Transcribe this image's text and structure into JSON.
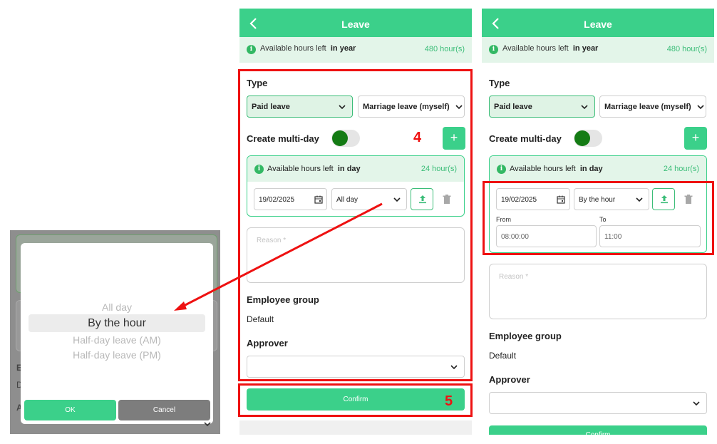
{
  "picker": {
    "options": [
      "All day",
      "By the hour",
      "Half-day leave (AM)",
      "Half-day leave (PM)"
    ],
    "selected_index": 1,
    "ok_label": "OK",
    "cancel_label": "Cancel",
    "ghost_letters": [
      "E",
      "D",
      "A"
    ]
  },
  "screen1": {
    "header_title": "Leave",
    "avail_label": "Available hours left",
    "avail_period": "in year",
    "avail_hours": "480 hour(s)",
    "type_label": "Type",
    "leave_type": "Paid leave",
    "leave_subtype": "Marriage leave (myself)",
    "multiday_label": "Create multi-day",
    "plus_symbol": "+",
    "day_avail_label": "Available hours left",
    "day_avail_period": "in day",
    "day_avail_hours": "24 hour(s)",
    "date_value": "19/02/2025",
    "duration_value": "All day",
    "reason_placeholder": "Reason *",
    "employee_group_label": "Employee group",
    "employee_group_value": "Default",
    "approver_label": "Approver",
    "confirm_label": "Confirm"
  },
  "screen2": {
    "header_title": "Leave",
    "avail_label": "Available hours left",
    "avail_period": "in year",
    "avail_hours": "480 hour(s)",
    "type_label": "Type",
    "leave_type": "Paid leave",
    "leave_subtype": "Marriage leave (myself)",
    "multiday_label": "Create multi-day",
    "plus_symbol": "+",
    "day_avail_label": "Available hours left",
    "day_avail_period": "in day",
    "day_avail_hours": "24 hour(s)",
    "date_value": "19/02/2025",
    "duration_value": "By the hour",
    "from_label": "From",
    "to_label": "To",
    "from_value": "08:00:00",
    "to_value": "11:00",
    "reason_placeholder": "Reason *",
    "employee_group_label": "Employee group",
    "employee_group_value": "Default",
    "approver_label": "Approver",
    "confirm_label": "Confirm"
  },
  "annotations": {
    "step_a": "4",
    "step_b": "5"
  },
  "colors": {
    "accent": "#3bd08a",
    "light_green": "#e3f5e9",
    "annotation_red": "#e11111",
    "toggle_knob": "#147b14"
  }
}
